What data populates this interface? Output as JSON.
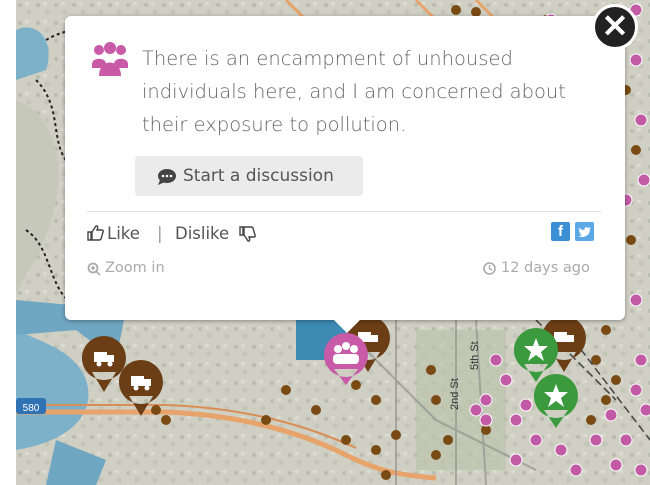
{
  "popup": {
    "close_icon": "close-icon",
    "author_icon": "people-group-icon",
    "comment": "There is an encampment of unhoused individuals here, and I am concerned about their exposure to pollution.",
    "discuss_icon": "speech-bubble-icon",
    "discuss_label": "Start a discussion",
    "like_label": "Like",
    "separator": "|",
    "dislike_label": "Dislike",
    "zoom_label": "Zoom in",
    "time_label": "12 days ago",
    "facebook_label": "f",
    "colors": {
      "comment_marker": "#c95aa8",
      "facebook": "#3b8fd4",
      "twitter": "#5aa9e6"
    }
  },
  "map": {
    "labels": {
      "street_5th": "5th St",
      "street_2nd": "2nd St",
      "highway": "580"
    },
    "colors": {
      "water": "#7db0c9",
      "land": "#cfcfc4",
      "truck_marker": "#6b3e15",
      "dot": "#7a4a14",
      "pink_dot": "#c25aa6",
      "star_marker": "#3a9a3d",
      "freeway": "#e8a36a"
    }
  }
}
